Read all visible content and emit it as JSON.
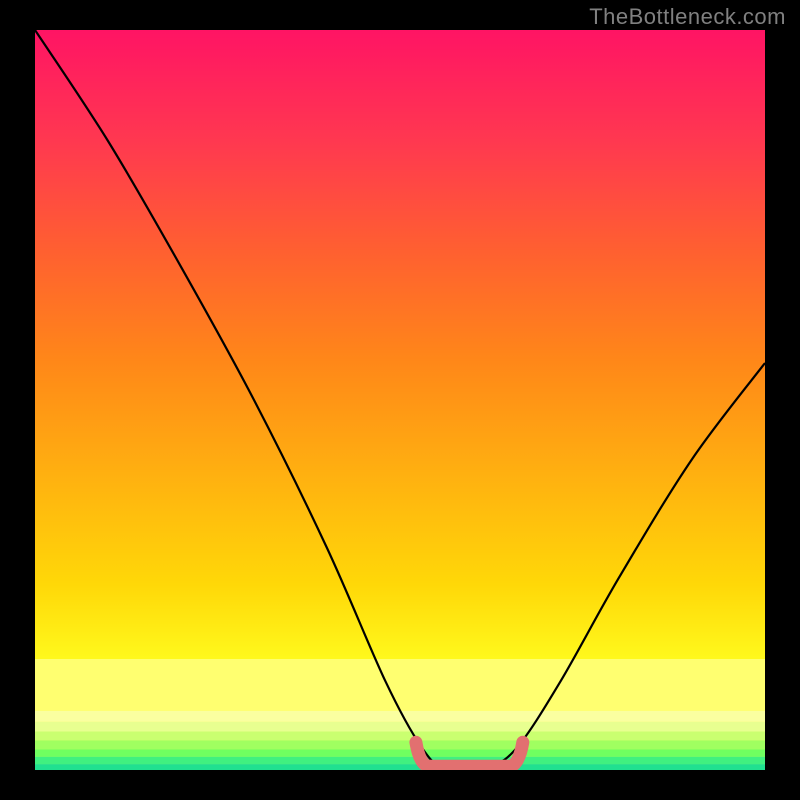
{
  "watermark": "TheBottleneck.com",
  "chart_data": {
    "type": "line",
    "title": "",
    "xlabel": "",
    "ylabel": "",
    "xlim": [
      0,
      100
    ],
    "ylim": [
      0,
      100
    ],
    "curve": [
      {
        "x": 0,
        "y": 100
      },
      {
        "x": 10,
        "y": 85
      },
      {
        "x": 20,
        "y": 68
      },
      {
        "x": 30,
        "y": 50
      },
      {
        "x": 40,
        "y": 30
      },
      {
        "x": 48,
        "y": 12
      },
      {
        "x": 53,
        "y": 3
      },
      {
        "x": 56,
        "y": 0.5
      },
      {
        "x": 62,
        "y": 0.5
      },
      {
        "x": 66,
        "y": 3
      },
      {
        "x": 72,
        "y": 12
      },
      {
        "x": 80,
        "y": 26
      },
      {
        "x": 90,
        "y": 42
      },
      {
        "x": 100,
        "y": 55
      }
    ],
    "bottom_bands": [
      {
        "color": "#ffff70",
        "y0": 8,
        "y1": 15
      },
      {
        "color": "#faffa0",
        "y0": 6.5,
        "y1": 8
      },
      {
        "color": "#e8ff90",
        "y0": 5.2,
        "y1": 6.5
      },
      {
        "color": "#caff70",
        "y0": 4.0,
        "y1": 5.2
      },
      {
        "color": "#a0ff60",
        "y0": 2.8,
        "y1": 4.0
      },
      {
        "color": "#70ff60",
        "y0": 1.8,
        "y1": 2.8
      },
      {
        "color": "#40f080",
        "y0": 0.8,
        "y1": 1.8
      },
      {
        "color": "#20e090",
        "y0": 0,
        "y1": 0.8
      }
    ],
    "marker": {
      "x_start": 53,
      "x_end": 66,
      "y": 0.5,
      "color": "#e27070"
    },
    "gradient_stops": [
      {
        "pct": 0,
        "color": "#ff1464"
      },
      {
        "pct": 15,
        "color": "#ff3850"
      },
      {
        "pct": 30,
        "color": "#ff6030"
      },
      {
        "pct": 45,
        "color": "#ff8818"
      },
      {
        "pct": 60,
        "color": "#ffb010"
      },
      {
        "pct": 75,
        "color": "#ffd808"
      },
      {
        "pct": 87,
        "color": "#ffff20"
      },
      {
        "pct": 100,
        "color": "#ffff60"
      }
    ]
  }
}
